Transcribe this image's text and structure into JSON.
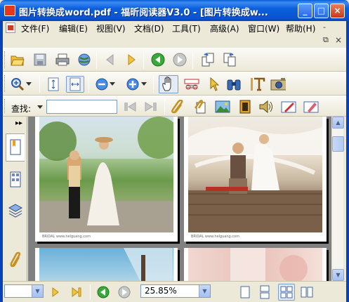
{
  "window": {
    "title": "图片转换成word.pdf - 福昕阅读器V3.0 - [图片转换成w...",
    "controls": {
      "minimize": "_",
      "maximize": "□",
      "close": "×"
    }
  },
  "menu": {
    "items": [
      "文件(F)",
      "编辑(E)",
      "视图(V)",
      "文档(D)",
      "工具(T)",
      "高级(A)",
      "窗口(W)",
      "帮助(H)"
    ],
    "mdi_minimize": "-",
    "mdi_restore": "⧉",
    "mdi_close": "×"
  },
  "find": {
    "label": "查找:",
    "value": ""
  },
  "pages": {
    "footer_text": "BRIDAL  www.helguang.com"
  },
  "status": {
    "page_combo": "",
    "zoom": "25.85%"
  },
  "colors": {
    "titlebar": "#0a55cf",
    "doc_background": "#808080",
    "chrome": "#ece9d8"
  }
}
